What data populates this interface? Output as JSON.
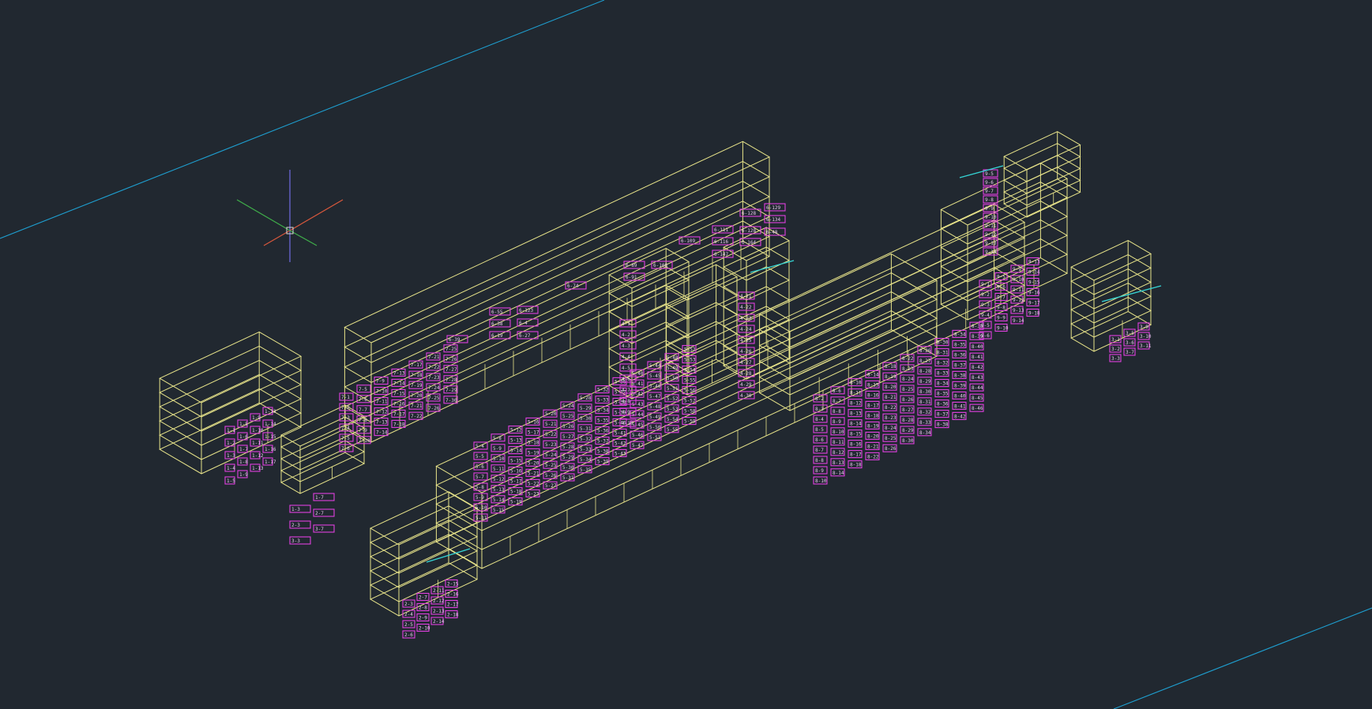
{
  "viewport": {
    "mode": "3D Wireframe",
    "background": "#212830"
  },
  "colors": {
    "building_edges": "#e8e48a",
    "room_tags": "#e040e0",
    "room_tag_text": "#f2d8f5",
    "construction_lines": "#1e9fd0",
    "highlight_edges": "#35d4d4",
    "axis_x": "#d9583c",
    "axis_y": "#3fae4a",
    "axis_z": "#6f6ae0"
  },
  "icons": {
    "ucs": "ucs-axis-icon",
    "crosshair": "cursor-crosshair-icon"
  },
  "room_tags": {
    "top_row": [
      "6-39",
      "6-55",
      "6-74",
      "6-89",
      "6-109",
      "6-111",
      "6-128",
      "6-129",
      "6-116",
      "6-128",
      "6-134",
      "6-147",
      "6-164",
      "6-48",
      "6-38",
      "6-123",
      "6-91",
      "6-108",
      "6-19",
      "6-4",
      "6-27"
    ],
    "bottom_row": [
      "5-4",
      "5-8",
      "5-12",
      "5-16",
      "5-20",
      "5-24",
      "5-28",
      "5-32",
      "5-36",
      "5-40",
      "5-44",
      "5-48",
      "5-52",
      "5-56",
      "5-60"
    ],
    "side_block": [
      "1-3",
      "1-7",
      "2-3",
      "2-7",
      "3-3",
      "3-7"
    ]
  }
}
